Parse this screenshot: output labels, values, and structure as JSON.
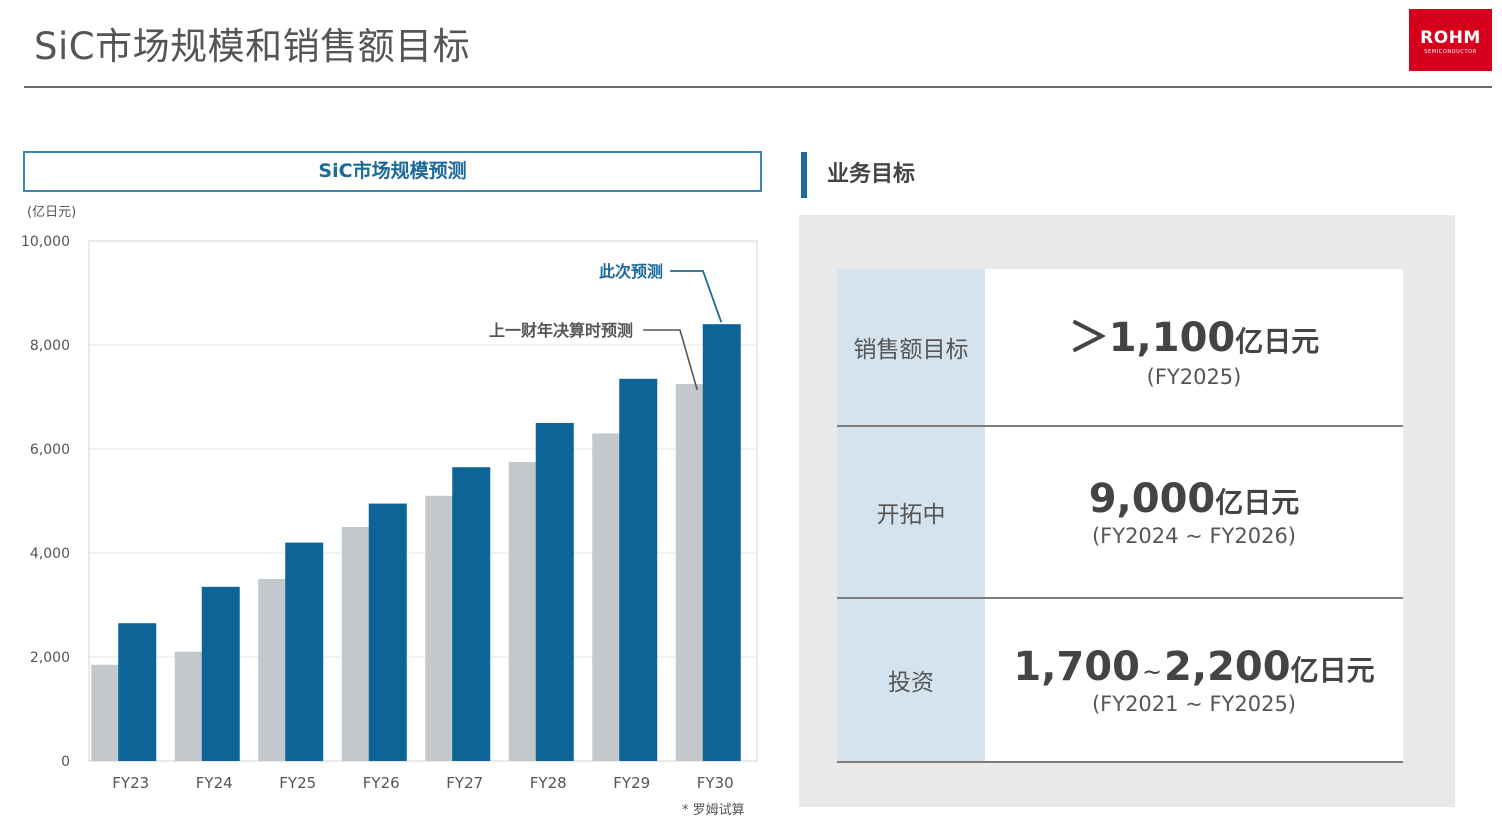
{
  "page": {
    "title": "SiC市场规模和销售额目标",
    "logo": {
      "brand": "ROHM",
      "sub": "SEMICONDUCTOR",
      "color": "#d6001c"
    }
  },
  "chart_data": {
    "type": "bar",
    "title": "SiC市场规模预测",
    "unit_label": "(亿日元)",
    "categories": [
      "FY23",
      "FY24",
      "FY25",
      "FY26",
      "FY27",
      "FY28",
      "FY29",
      "FY30"
    ],
    "series": [
      {
        "name": "上一财年决算时预测",
        "color": "#c3c8cc",
        "values": [
          1850,
          2100,
          3500,
          4500,
          5100,
          5750,
          6300,
          7250
        ]
      },
      {
        "name": "此次预测",
        "color": "#0d6496",
        "values": [
          2650,
          3350,
          4200,
          4950,
          5650,
          6500,
          7350,
          8400
        ]
      }
    ],
    "ylim": [
      0,
      10000
    ],
    "yticks": [
      "0",
      "2,000",
      "4,000",
      "6,000",
      "8,000",
      "10,000"
    ],
    "grid": true,
    "annotations": [
      {
        "text": "此次预测",
        "target": "FY30 此次预测"
      },
      {
        "text": "上一财年决算时预测",
        "target": "FY30 上一财年决算时预测"
      }
    ],
    "note": "* 罗姆试算"
  },
  "goals": {
    "heading": "业务目标",
    "accent": "#1b6a99",
    "rows": [
      {
        "label": "销售额目标",
        "prefix": "＞",
        "amount": "1,100",
        "unit": "亿日元",
        "period": "(FY2025)"
      },
      {
        "label": "开拓中",
        "amount": "9,000",
        "unit": "亿日元",
        "period": "(FY2024 ~ FY2026)"
      },
      {
        "label": "投资",
        "amount_from": "1,700",
        "tilde": "~",
        "amount_to": "2,200",
        "unit": "亿日元",
        "period": "(FY2021 ~ FY2025)"
      }
    ]
  }
}
